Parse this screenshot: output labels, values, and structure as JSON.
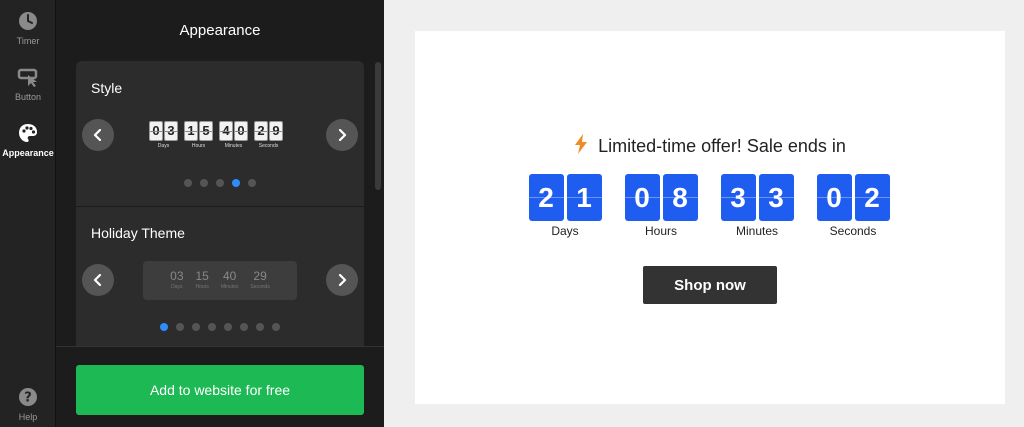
{
  "rail": {
    "items": [
      {
        "label": "Timer",
        "icon": "clock-icon"
      },
      {
        "label": "Button",
        "icon": "cursor-button-icon"
      },
      {
        "label": "Appearance",
        "icon": "palette-icon"
      }
    ],
    "help": {
      "label": "Help",
      "icon": "help-icon"
    }
  },
  "panel": {
    "title": "Appearance",
    "style_card": {
      "label": "Style",
      "preview": {
        "units": [
          {
            "digits": [
              "0",
              "3"
            ],
            "label": "Days"
          },
          {
            "digits": [
              "1",
              "5"
            ],
            "label": "Hours"
          },
          {
            "digits": [
              "4",
              "0"
            ],
            "label": "Minutes"
          },
          {
            "digits": [
              "2",
              "9"
            ],
            "label": "Seconds"
          }
        ]
      },
      "dot_count": 5,
      "active_dot": 4
    },
    "holiday_card": {
      "label": "Holiday Theme",
      "preview": {
        "units": [
          {
            "value": "03",
            "label": "Days"
          },
          {
            "value": "15",
            "label": "Hours"
          },
          {
            "value": "40",
            "label": "Minutes"
          },
          {
            "value": "29",
            "label": "Seconds"
          }
        ]
      },
      "dot_count": 8,
      "active_dot": 1
    },
    "add_button": "Add to website for free"
  },
  "preview": {
    "headline": "Limited-time offer! Sale ends in",
    "headline_icon": "lightning-icon",
    "countdown": [
      {
        "digits": [
          "2",
          "1"
        ],
        "label": "Days"
      },
      {
        "digits": [
          "0",
          "8"
        ],
        "label": "Hours"
      },
      {
        "digits": [
          "3",
          "3"
        ],
        "label": "Minutes"
      },
      {
        "digits": [
          "0",
          "2"
        ],
        "label": "Seconds"
      }
    ],
    "button": "Shop now"
  },
  "colors": {
    "accent_blue": "#1f5cf0",
    "green": "#1db954",
    "lightning": "#f08a24",
    "active_dot": "#2f8cff"
  }
}
